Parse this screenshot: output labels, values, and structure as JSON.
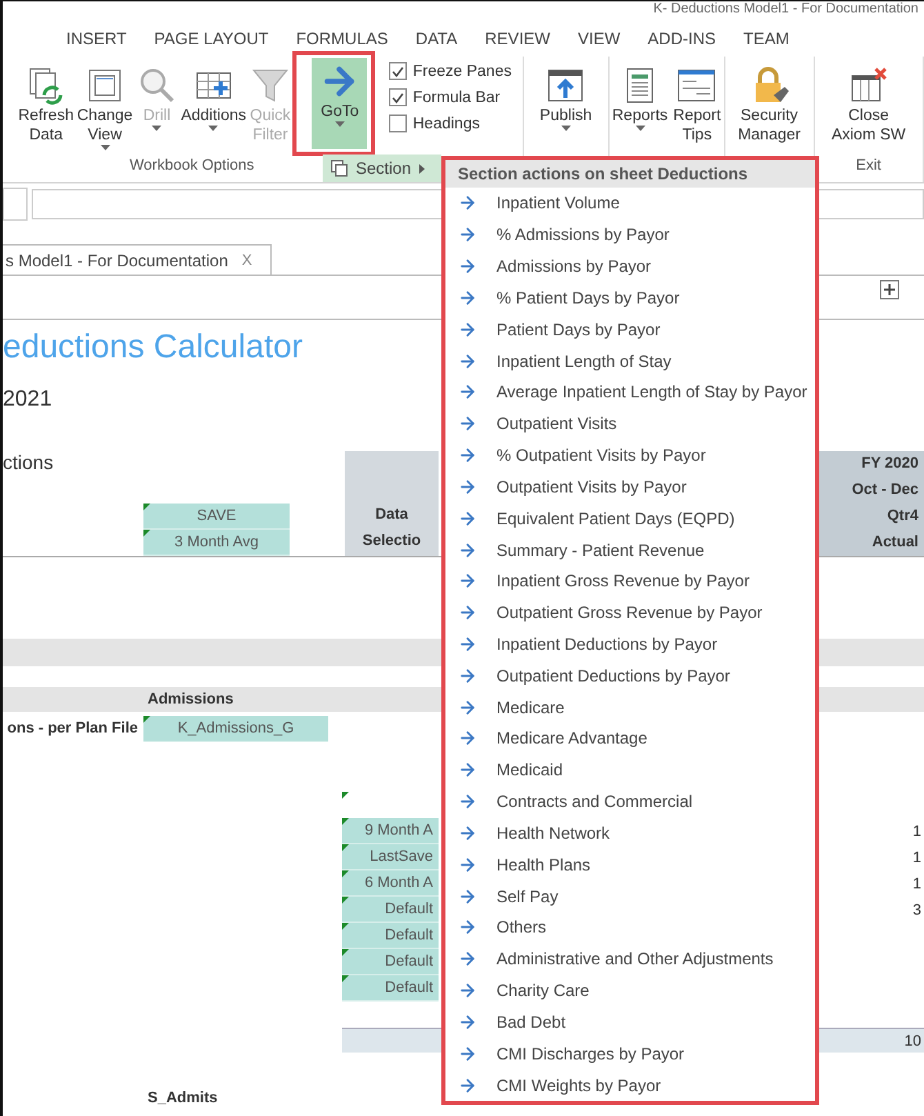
{
  "window": {
    "title": "K- Deductions Model1 - For Documentation"
  },
  "ribbon_tabs": [
    "INSERT",
    "PAGE LAYOUT",
    "FORMULAS",
    "DATA",
    "REVIEW",
    "VIEW",
    "ADD-INS",
    "TEAM"
  ],
  "ribbon": {
    "groups": [
      {
        "label": "Workbook Options",
        "buttons": [
          {
            "kind": "refresh",
            "lines": [
              "Refresh",
              "Data"
            ],
            "dropdown": false,
            "disabled": false,
            "highlighted": false
          },
          {
            "kind": "view",
            "lines": [
              "Change",
              "View"
            ],
            "dropdown": true,
            "disabled": false,
            "highlighted": false
          },
          {
            "kind": "drill",
            "lines": [
              "Drill"
            ],
            "dropdown": true,
            "disabled": true,
            "highlighted": false
          },
          {
            "kind": "additions",
            "lines": [
              "Additions"
            ],
            "dropdown": true,
            "disabled": false,
            "highlighted": false
          },
          {
            "kind": "filter",
            "lines": [
              "Quick",
              "Filter"
            ],
            "dropdown": false,
            "disabled": true,
            "highlighted": false
          },
          {
            "kind": "goto",
            "lines": [
              "GoTo"
            ],
            "dropdown": true,
            "disabled": false,
            "highlighted": true
          }
        ],
        "checkboxes": [
          {
            "label": "Freeze Panes",
            "checked": true
          },
          {
            "label": "Formula Bar",
            "checked": true
          },
          {
            "label": "Headings",
            "checked": false
          }
        ]
      },
      {
        "buttons": [
          {
            "kind": "publish",
            "lines": [
              "Publish"
            ],
            "dropdown": true,
            "disabled": false,
            "highlighted": false
          }
        ]
      },
      {
        "buttons": [
          {
            "kind": "reports",
            "lines": [
              "Reports"
            ],
            "dropdown": true,
            "disabled": false,
            "highlighted": false
          },
          {
            "kind": "tips",
            "lines": [
              "Report",
              "Tips"
            ],
            "dropdown": false,
            "disabled": false,
            "highlighted": false
          }
        ]
      },
      {
        "buttons": [
          {
            "kind": "security",
            "lines": [
              "Security",
              "Manager"
            ],
            "dropdown": false,
            "disabled": false,
            "highlighted": false
          }
        ]
      },
      {
        "label": "Exit",
        "buttons": [
          {
            "kind": "close",
            "lines": [
              "Close",
              "Axiom SW"
            ],
            "dropdown": false,
            "disabled": false,
            "highlighted": false
          }
        ]
      }
    ]
  },
  "submenu": {
    "label": "Section",
    "highlighted": true
  },
  "menu": {
    "header": "Section actions on sheet Deductions",
    "items": [
      "Inpatient Volume",
      "% Admissions by Payor",
      "Admissions by Payor",
      "% Patient Days by Payor",
      "Patient Days by Payor",
      "Inpatient Length of Stay",
      "Average Inpatient Length of Stay by Payor",
      "Outpatient Visits",
      "% Outpatient Visits by Payor",
      "Outpatient Visits by Payor",
      "Equivalent Patient Days (EQPD)",
      "Summary - Patient Revenue",
      "Inpatient Gross Revenue by Payor",
      "Outpatient Gross Revenue by Payor",
      "Inpatient Deductions by Payor",
      "Outpatient Deductions by Payor",
      "Medicare",
      "Medicare Advantage",
      "Medicaid",
      "Contracts and Commercial",
      "Health Network",
      "Health Plans",
      "Self Pay",
      "Others",
      "Administrative and Other Adjustments",
      "Charity Care",
      "Bad Debt",
      "CMI Discharges by Payor",
      "CMI Weights by Payor"
    ]
  },
  "workbook_tab": {
    "label": "s Model1 - For Documentation",
    "close": "X"
  },
  "sheet": {
    "title": "eductions Calculator",
    "year": "2021",
    "section_label": "ctions",
    "save_cells": [
      "SAVE",
      "3 Month Avg"
    ],
    "data_selection": [
      "Data",
      "Selectio"
    ],
    "period_header": [
      "FY 2020",
      "Oct - Dec",
      "Qtr4",
      "Actual"
    ],
    "admissions_header": "Admissions",
    "plan_row": {
      "label": "ons - per Plan File",
      "cell": "K_Admissions_G"
    },
    "selection_rows": [
      {
        "cell": "9 Month A",
        "value": "1"
      },
      {
        "cell": "LastSave",
        "value": "1"
      },
      {
        "cell": "6 Month A",
        "value": "1"
      },
      {
        "cell": "Default",
        "value": "3"
      },
      {
        "cell": "Default"
      },
      {
        "cell": "Default"
      },
      {
        "cell": "Default"
      }
    ],
    "total_value": "10",
    "footer_label": "S_Admits"
  }
}
